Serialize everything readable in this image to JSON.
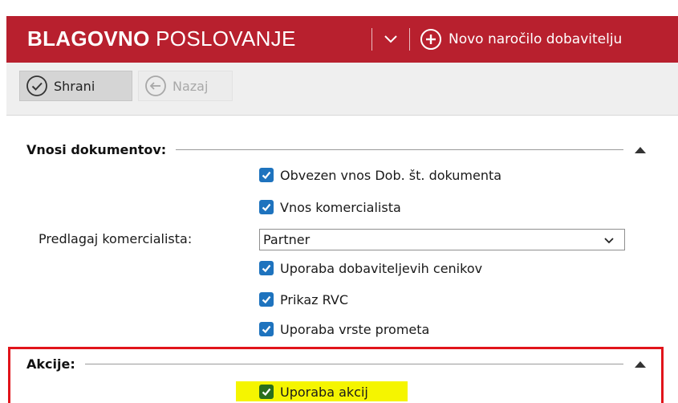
{
  "header": {
    "title_bold": "BLAGOVNO",
    "title_rest": "POSLOVANJE",
    "new_order_label": "Novo naročilo dobavitelju"
  },
  "toolbar": {
    "save_label": "Shrani",
    "back_label": "Nazaj"
  },
  "sections": [
    {
      "title": "Vnosi dokumentov:",
      "items": [
        {
          "label": "Obvezen vnos Dob. št. dokumenta",
          "checked": true
        },
        {
          "label": "Vnos komercialista",
          "checked": true
        },
        {
          "label": "Uporaba dobaviteljevih cenikov",
          "checked": true
        },
        {
          "label": "Prikaz RVC",
          "checked": true
        },
        {
          "label": "Uporaba vrste prometa",
          "checked": true
        }
      ],
      "field": {
        "label": "Predlagaj komercialista:",
        "value": "Partner"
      }
    },
    {
      "title": "Akcije:",
      "items": [
        {
          "label": "Uporaba akcij",
          "checked": true
        }
      ]
    }
  ],
  "colors": {
    "header_bg": "#b8202e",
    "checkbox": "#1e73be",
    "highlight_border": "#e1141b",
    "highlight_marker": "#f5f500"
  }
}
